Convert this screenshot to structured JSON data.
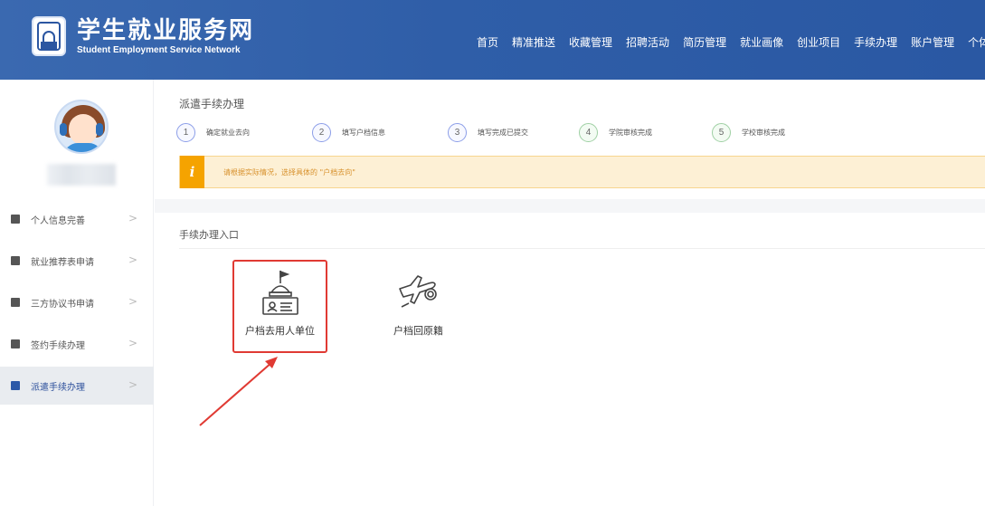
{
  "header": {
    "title_cn": "学生就业服务网",
    "title_en": "Student Employment Service Network",
    "nav": [
      "首页",
      "精准推送",
      "收藏管理",
      "招聘活动",
      "简历管理",
      "就业画像",
      "创业项目",
      "手续办理",
      "账户管理",
      "个体咨询"
    ]
  },
  "sidebar": {
    "items": [
      {
        "label": "个人信息完善",
        "icon": "user-icon"
      },
      {
        "label": "就业推荐表申请",
        "icon": "document-icon"
      },
      {
        "label": "三方协议书申请",
        "icon": "document-icon"
      },
      {
        "label": "签约手续办理",
        "icon": "calendar-icon"
      },
      {
        "label": "派遣手续办理",
        "icon": "map-icon",
        "active": true
      }
    ]
  },
  "main": {
    "section_title": "派遣手续办理",
    "steps": [
      {
        "num": "1",
        "label": "确定就业去向"
      },
      {
        "num": "2",
        "label": "填写户档信息"
      },
      {
        "num": "3",
        "label": "填写完成已提交"
      },
      {
        "num": "4",
        "label": "学院审核完成"
      },
      {
        "num": "5",
        "label": "学校审核完成"
      }
    ],
    "tip_badge": "i",
    "tip_text": "请根据实际情况，选择具体的 \"户档去向\"",
    "entry_title": "手续办理入口",
    "cards": [
      {
        "label": "户档去用人单位",
        "icon": "building-id-icon"
      },
      {
        "label": "户档回原籍",
        "icon": "plane-icon"
      }
    ]
  },
  "colors": {
    "header_bg": "#2f5ea8",
    "highlight_border": "#e03a33",
    "tip_bg": "#fdf0d5",
    "tip_badge": "#f5a300"
  }
}
